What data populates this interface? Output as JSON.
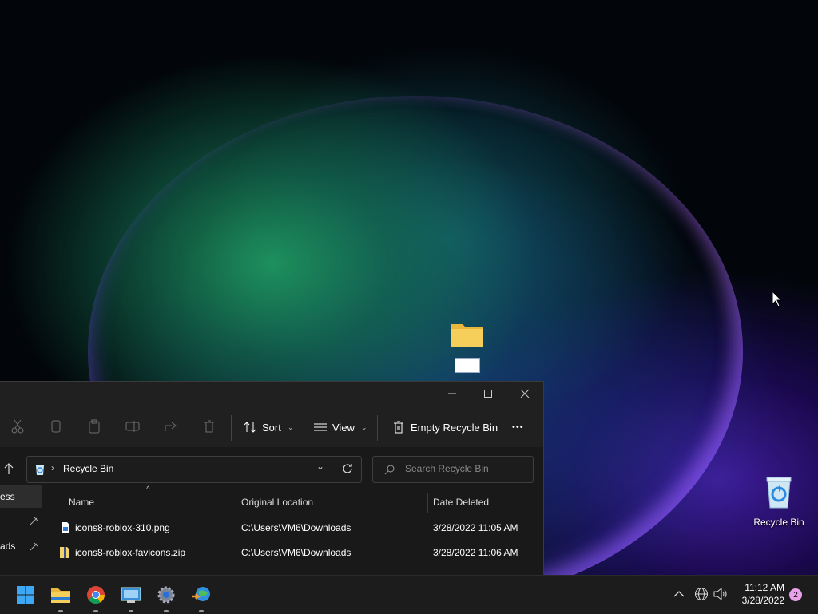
{
  "desktop": {
    "recycle_bin_label": "Recycle Bin"
  },
  "explorer": {
    "toolbar": {
      "sort_label": "Sort",
      "view_label": "View",
      "empty_label": "Empty Recycle Bin",
      "more_label": "•••"
    },
    "address": {
      "path": "Recycle Bin",
      "search_placeholder": "Search Recycle Bin"
    },
    "nav": {
      "items": [
        "ess",
        "ads"
      ]
    },
    "columns": {
      "name": "Name",
      "location": "Original Location",
      "date": "Date Deleted"
    },
    "files": [
      {
        "name": "icons8-roblox-310.png",
        "location": "C:\\Users\\VM6\\Downloads",
        "date": "3/28/2022 11:05 AM"
      },
      {
        "name": "icons8-roblox-favicons.zip",
        "location": "C:\\Users\\VM6\\Downloads",
        "date": "3/28/2022 11:06 AM"
      }
    ]
  },
  "taskbar": {
    "time": "11:12 AM",
    "date": "3/28/2022",
    "notification_count": "2"
  },
  "colors": {
    "accent": "#0078d4",
    "folder": "#f3c84b",
    "explorer_bg": "#202020",
    "taskbar_bg": "#1c1c1c"
  }
}
